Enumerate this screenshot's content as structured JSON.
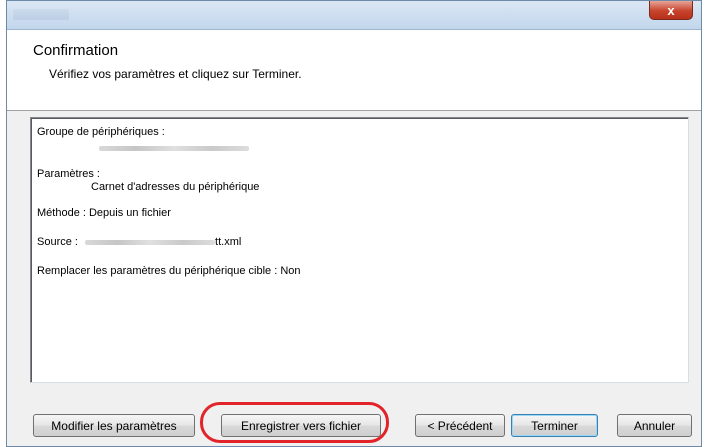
{
  "window": {
    "close_label": "x"
  },
  "header": {
    "title": "Confirmation",
    "subtitle": "Vérifiez vos paramètres et cliquez sur Terminer."
  },
  "summary": {
    "device_group_label": "Groupe de périphériques :",
    "settings_label": "Paramètres :",
    "settings_value": "Carnet d'adresses du périphérique",
    "method": "Méthode : Depuis un fichier",
    "source_label": "Source :",
    "source_value_suffix": "tt.xml",
    "replace_settings": "Remplacer les paramètres du périphérique cible : Non"
  },
  "buttons": {
    "modify": "Modifier les paramètres",
    "save_to_file": "Enregistrer vers fichier",
    "previous": "< Précédent",
    "finish": "Terminer",
    "cancel": "Annuler"
  },
  "colors": {
    "highlight_ring": "#e2232a",
    "close_button": "#c7432c",
    "title_bar": "#c2d6ec"
  }
}
